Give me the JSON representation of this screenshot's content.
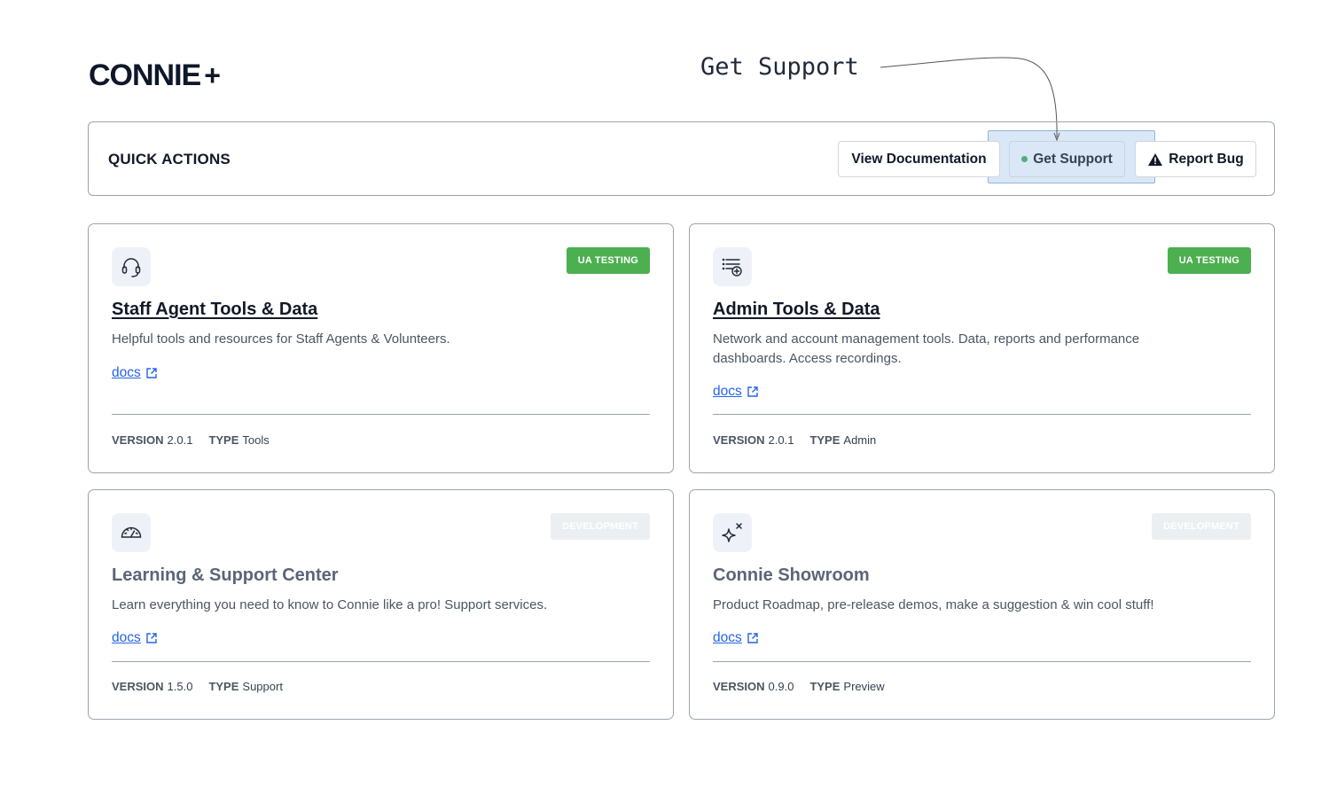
{
  "logo": {
    "text": "CONNIE",
    "plus": "+"
  },
  "annotation": {
    "label": "Get Support"
  },
  "quick_actions": {
    "title": "QUICK ACTIONS",
    "view_docs": "View Documentation",
    "get_support": "Get Support",
    "report_bug": "Report Bug"
  },
  "meta_labels": {
    "version": "VERSION",
    "type": "TYPE"
  },
  "cards": [
    {
      "icon": "headset-icon",
      "badge": "UA TESTING",
      "title": "Staff Agent Tools & Data",
      "description": "Helpful tools and resources for Staff Agents & Volunteers.",
      "docs_label": "docs",
      "version": "2.0.1",
      "type": "Tools"
    },
    {
      "icon": "list-add-icon",
      "badge": "UA TESTING",
      "title": "Admin Tools & Data",
      "description": "Network and account management tools. Data, reports and performance dashboards. Access recordings.",
      "docs_label": "docs",
      "version": "2.0.1",
      "type": "Admin"
    },
    {
      "icon": "gauge-icon",
      "badge": "DEVELOPMENT",
      "title": "Learning & Support Center",
      "description": "Learn everything you need to know to Connie like a pro! Support services.",
      "docs_label": "docs",
      "version": "1.5.0",
      "type": "Support"
    },
    {
      "icon": "sparkle-icon",
      "badge": "DEVELOPMENT",
      "title": "Connie Showroom",
      "description": "Product Roadmap, pre-release demos, make a suggestion & win cool stuff!",
      "docs_label": "docs",
      "version": "0.9.0",
      "type": "Preview"
    }
  ],
  "colors": {
    "badge_green": "#4caf50",
    "badge_grey": "#eceff2",
    "link_blue": "#2563eb",
    "status_dot": "#4caf7d"
  }
}
